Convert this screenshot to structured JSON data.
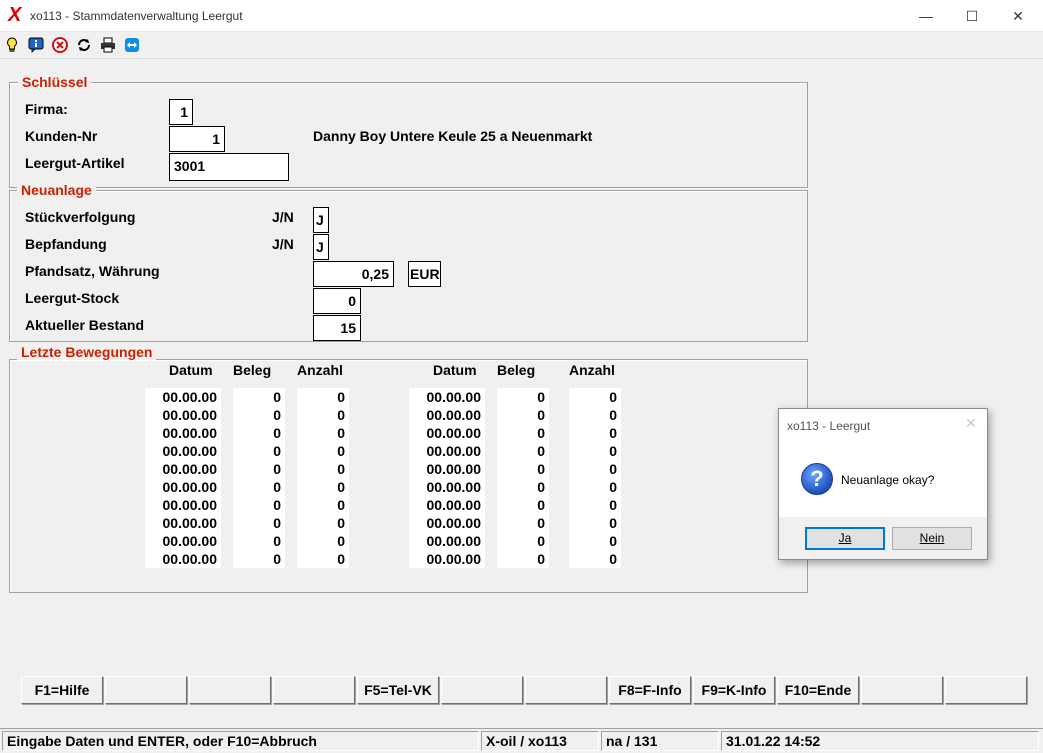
{
  "window": {
    "title": "xo113 - Stammdatenverwaltung Leergut",
    "logo": "X",
    "controls": {
      "minimize": "—",
      "maximize": "☐",
      "close": "✕"
    }
  },
  "toolbar": {
    "icons": [
      "lightbulb-icon",
      "info-icon",
      "cancel-icon",
      "refresh-icon",
      "printer-icon",
      "teamviewer-icon"
    ]
  },
  "schluessel": {
    "title": "Schlüssel",
    "firma_label": "Firma:",
    "firma_value": "1",
    "kunden_label": "Kunden-Nr",
    "kunden_value": "1",
    "kunden_info": "Danny Boy Untere Keule 25 a Neuenmarkt",
    "artikel_label": "Leergut-Artikel",
    "artikel_value": "3001"
  },
  "neuanlage": {
    "title": "Neuanlage",
    "stueck_label": "Stückverfolgung",
    "stueck_hint": "J/N",
    "stueck_value": "J",
    "pfand_label": "Bepfandung",
    "pfand_hint": "J/N",
    "pfand_value": "J",
    "satz_label": "Pfandsatz, Währung",
    "satz_value": "0,25",
    "waehrung_value": "EUR",
    "stock_label": "Leergut-Stock",
    "stock_value": "0",
    "bestand_label": "Aktueller Bestand",
    "bestand_value": "15"
  },
  "bewegungen": {
    "title": "Letzte Bewegungen",
    "headers": [
      "Datum",
      "Beleg",
      "Anzahl"
    ],
    "left_rows": [
      [
        "00.00.00",
        "0",
        "0"
      ],
      [
        "00.00.00",
        "0",
        "0"
      ],
      [
        "00.00.00",
        "0",
        "0"
      ],
      [
        "00.00.00",
        "0",
        "0"
      ],
      [
        "00.00.00",
        "0",
        "0"
      ],
      [
        "00.00.00",
        "0",
        "0"
      ],
      [
        "00.00.00",
        "0",
        "0"
      ],
      [
        "00.00.00",
        "0",
        "0"
      ],
      [
        "00.00.00",
        "0",
        "0"
      ],
      [
        "00.00.00",
        "0",
        "0"
      ]
    ],
    "right_rows": [
      [
        "00.00.00",
        "0",
        "0"
      ],
      [
        "00.00.00",
        "0",
        "0"
      ],
      [
        "00.00.00",
        "0",
        "0"
      ],
      [
        "00.00.00",
        "0",
        "0"
      ],
      [
        "00.00.00",
        "0",
        "0"
      ],
      [
        "00.00.00",
        "0",
        "0"
      ],
      [
        "00.00.00",
        "0",
        "0"
      ],
      [
        "00.00.00",
        "0",
        "0"
      ],
      [
        "00.00.00",
        "0",
        "0"
      ],
      [
        "00.00.00",
        "0",
        "0"
      ]
    ]
  },
  "fkeys": [
    "F1=Hilfe",
    "",
    "",
    "",
    "F5=Tel-VK",
    "",
    "",
    "F8=F-Info",
    "F9=K-Info",
    "F10=Ende",
    "",
    ""
  ],
  "status": {
    "message": "Eingabe Daten und ENTER, oder F10=Abbruch",
    "app": "X-oil / xo113",
    "user": "na / 131",
    "datetime": "31.01.22 14:52"
  },
  "dialog": {
    "title": "xo113 - Leergut",
    "close": "✕",
    "message": "Neuanlage okay?",
    "yes_label": "Ja",
    "no_label": "Nein"
  },
  "colors": {
    "section_title": "#cc2200",
    "logo": "#e00000",
    "dialog_default_border": "#0078d7"
  }
}
